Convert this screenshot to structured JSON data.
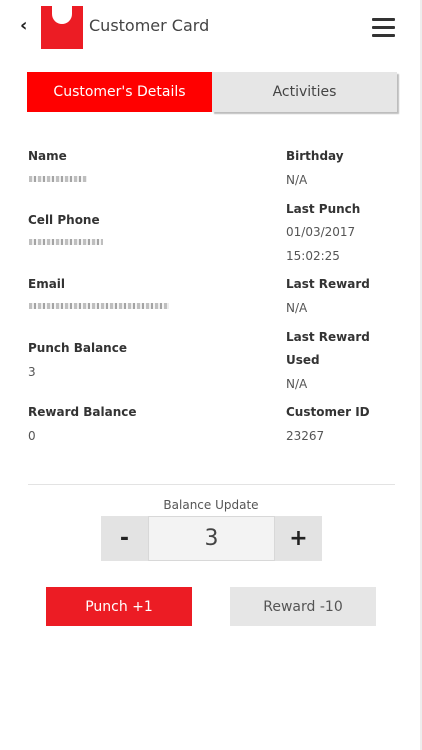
{
  "header": {
    "back_icon": "chevron-left-icon",
    "title": "Customer Card",
    "menu_icon": "hamburger-menu-icon",
    "brand_color": "#ec1c24"
  },
  "tabs": [
    {
      "label": "Customer's Details",
      "active": true
    },
    {
      "label": "Activities",
      "active": false
    }
  ],
  "details": {
    "name_label": "Name",
    "cell_phone_label": "Cell Phone",
    "email_label": "Email",
    "punch_balance_label": "Punch Balance",
    "punch_balance_value": "3",
    "reward_balance_label": "Reward Balance",
    "reward_balance_value": "0",
    "birthday_label": "Birthday",
    "birthday_value": "N/A",
    "last_punch_label": "Last Punch",
    "last_punch_date": "01/03/2017",
    "last_punch_time": "15:02:25",
    "last_reward_label": "Last Reward",
    "last_reward_value": "N/A",
    "last_reward_used_label_1": "Last Reward",
    "last_reward_used_label_2": "Used",
    "last_reward_used_value": "N/A",
    "customer_id_label": "Customer ID",
    "customer_id_value": "23267"
  },
  "balance_update": {
    "label": "Balance Update",
    "minus": "-",
    "value": "3",
    "plus": "+"
  },
  "actions": {
    "punch_label": "Punch +1",
    "reward_label": "Reward -10"
  }
}
